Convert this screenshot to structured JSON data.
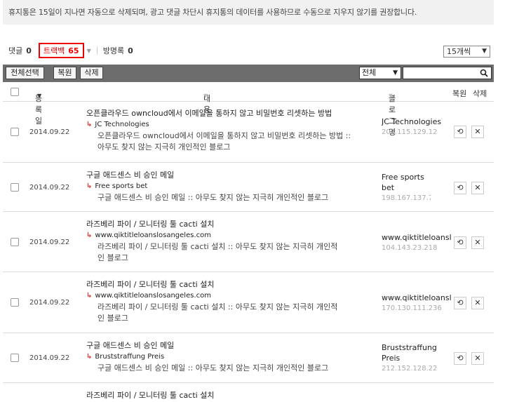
{
  "notice": "휴지통은 15일이 지나면 자동으로 삭제되며, 광고 댓글 차단시 휴지통의 데이터를 사용하므로 수동으로 지우지 않기를 권장합니다.",
  "tabs": {
    "comments": {
      "label": "댓글",
      "count": "0"
    },
    "trackbacks": {
      "label": "트랙백",
      "count": "65"
    },
    "guestbook": {
      "label": "방명록",
      "count": "0"
    }
  },
  "per_page": "15개씩",
  "toolbar": {
    "select_all": "전체선택",
    "restore": "복원",
    "delete": "삭제",
    "filter": "전체",
    "search_placeholder": ""
  },
  "columns": {
    "date": "등록일",
    "content": "내용",
    "blog": "블로그명",
    "restore": "복원",
    "delete": "삭제"
  },
  "rows": [
    {
      "date": "2014.09.22",
      "title": "오픈클라우드 owncloud에서 이메일을 통하지 않고 비밀번호 리셋하는 방법",
      "source": "JC Technologies",
      "excerpt": "오픈클라우드 owncloud에서 이메일을 통하지 않고 비밀번호 리셋하는 방법 :: 아무도 찾지 않는 지극히 개인적인 블로그",
      "blog": "JC Technologies",
      "ip": "202.115.129.12"
    },
    {
      "date": "2014.09.22",
      "title": "구글 애드센스 비 승인 메일",
      "source": "Free sports bet",
      "excerpt": "구글 애드센스 비 승인 메일 :: 아무도 찾지 않는 지극히 개인적인 블로그",
      "blog": "Free sports bet",
      "ip": "198.167.137.75"
    },
    {
      "date": "2014.09.22",
      "title": "라즈베리 파이 / 모니터링 툴 cacti 설치",
      "source": "www.qiktitleloanslosangeles.com",
      "excerpt": "라즈베리 파이 / 모니터링 툴 cacti 설치 :: 아무도 찾지 않는 지극히 개인적인 블로그",
      "blog": "www.qiktitleloanslos",
      "ip": "104.143.23.218"
    },
    {
      "date": "2014.09.22",
      "title": "라즈베리 파이 / 모니터링 툴 cacti 설치",
      "source": "www.qiktitleloanslosangeles.com",
      "excerpt": "라즈베리 파이 / 모니터링 툴 cacti 설치 :: 아무도 찾지 않는 지극히 개인적인 블로그",
      "blog": "www.qiktitleloanslos",
      "ip": "170.130.111.236"
    },
    {
      "date": "2014.09.22",
      "title": "구글 애드센스 비 승인 메일",
      "source": "Bruststraffung Preis",
      "excerpt": "구글 애드센스 비 승인 메일 :: 아무도 찾지 않는 지극히 개인적인 블로그",
      "blog": "Bruststraffung Preis",
      "ip": "212.152.128.221"
    },
    {
      "title": "라즈베리 파이 / 모니터링 툴 cacti 설치"
    }
  ]
}
